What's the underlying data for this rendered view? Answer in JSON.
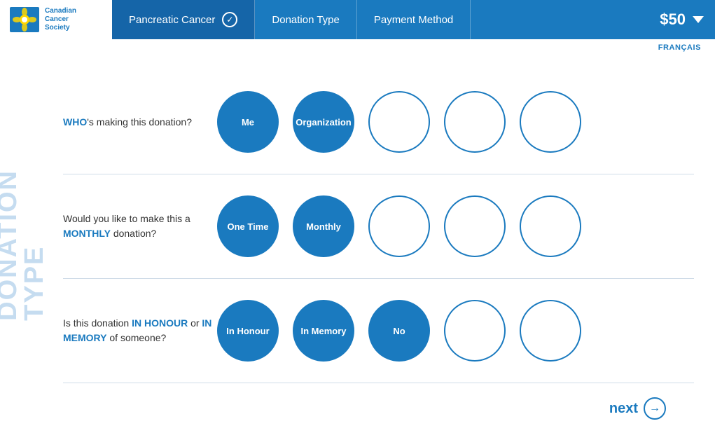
{
  "header": {
    "tab1_label": "Pancreatic Cancer",
    "tab2_label": "Donation Type",
    "tab3_label": "Payment Method",
    "amount": "$50",
    "lang_link": "FRANÇAIS"
  },
  "logo": {
    "line1": "Canadian",
    "line2": "Cancer",
    "line3": "Society"
  },
  "side_label": {
    "line1": "DONATION",
    "line2": "TYPE"
  },
  "row1": {
    "question_prefix": "WHO",
    "question_suffix": "'s making this donation?",
    "options": [
      {
        "label": "Me",
        "filled": true
      },
      {
        "label": "Organization",
        "filled": true
      },
      {
        "label": "",
        "filled": false
      },
      {
        "label": "",
        "filled": false
      },
      {
        "label": "",
        "filled": false
      }
    ]
  },
  "row2": {
    "question": "Would you like to make this a ",
    "bold": "MONTHLY",
    "question_suffix": " donation?",
    "options": [
      {
        "label": "One Time",
        "filled": true
      },
      {
        "label": "Monthly",
        "filled": true
      },
      {
        "label": "",
        "filled": false
      },
      {
        "label": "",
        "filled": false
      },
      {
        "label": "",
        "filled": false
      }
    ]
  },
  "row3": {
    "question": "Is this donation ",
    "bold1": "IN HONOUR",
    "question_mid": " or ",
    "bold2": "IN MEMORY",
    "question_suffix": " of someone?",
    "options": [
      {
        "label": "In Honour",
        "filled": true
      },
      {
        "label": "In Memory",
        "filled": true
      },
      {
        "label": "No",
        "filled": true
      },
      {
        "label": "",
        "filled": false
      },
      {
        "label": "",
        "filled": false
      }
    ]
  },
  "next_button": {
    "label": "next"
  }
}
